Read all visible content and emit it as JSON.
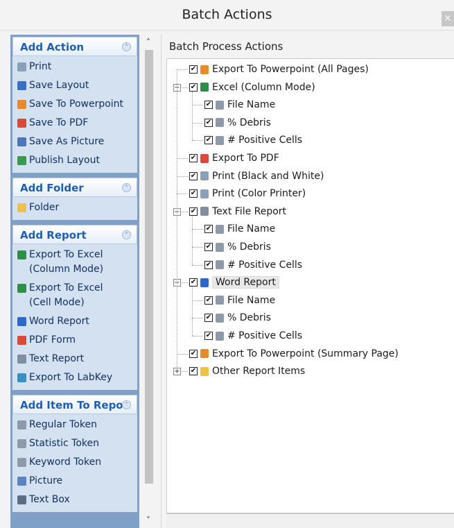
{
  "window": {
    "title": "Batch Actions",
    "close_glyph": "×"
  },
  "sidebar": {
    "sections": [
      {
        "title": "Add Action",
        "items": [
          {
            "label": "Print",
            "icon": "printer-icon",
            "color": "#8aa0b8"
          },
          {
            "label": "Save Layout",
            "icon": "floppy-icon",
            "color": "#3a6fc2"
          },
          {
            "label": "Save To Powerpoint",
            "icon": "powerpoint-icon",
            "color": "#e58b2f"
          },
          {
            "label": "Save To PDF",
            "icon": "pdf-icon",
            "color": "#d94a3a"
          },
          {
            "label": "Save As Picture",
            "icon": "picture-icon",
            "color": "#4b77b8"
          },
          {
            "label": "Publish Layout",
            "icon": "globe-icon",
            "color": "#3a9a4e"
          }
        ]
      },
      {
        "title": "Add Folder",
        "items": [
          {
            "label": "Folder",
            "icon": "folder-icon",
            "color": "#e9c34a"
          }
        ]
      },
      {
        "title": "Add Report",
        "items": [
          {
            "label": "Export To Excel\n(Column Mode)",
            "icon": "excel-icon",
            "color": "#2f8f4a"
          },
          {
            "label": "Export To Excel\n(Cell Mode)",
            "icon": "excel-icon",
            "color": "#2f8f4a"
          },
          {
            "label": "Word Report",
            "icon": "word-icon",
            "color": "#2f67c7"
          },
          {
            "label": "PDF Form",
            "icon": "pdf-icon",
            "color": "#d94a3a"
          },
          {
            "label": "Text Report",
            "icon": "text-file-icon",
            "color": "#7f8ea0"
          },
          {
            "label": "Export To LabKey",
            "icon": "labkey-icon",
            "color": "#3a8fc2"
          }
        ]
      },
      {
        "title": "Add Item To Repo",
        "items": [
          {
            "label": "Regular Token",
            "icon": "token-icon",
            "color": "#8e9aaa"
          },
          {
            "label": "Statistic Token",
            "icon": "token-icon",
            "color": "#8e9aaa"
          },
          {
            "label": "Keyword Token",
            "icon": "token-icon",
            "color": "#8e9aaa"
          },
          {
            "label": "Picture",
            "icon": "picture-icon",
            "color": "#5a84bd"
          },
          {
            "label": "Text Box",
            "icon": "textbox-icon",
            "color": "#5b6e86"
          }
        ]
      }
    ],
    "collapse_glyph": "˄"
  },
  "panel": {
    "title": "Batch Process Actions"
  },
  "tree": [
    {
      "label": "Export To Powerpoint (All Pages)",
      "icon": "powerpoint-icon",
      "color": "#e58b2f",
      "level": 1,
      "checked": true
    },
    {
      "label": "Excel (Column Mode)",
      "icon": "excel-icon",
      "color": "#2f8f4a",
      "level": 0,
      "checked": true,
      "expander": "−"
    },
    {
      "label": "File Name",
      "icon": "token-icon",
      "color": "#8e9aaa",
      "level": 2,
      "checked": true
    },
    {
      "label": "% Debris",
      "icon": "token-icon",
      "color": "#8e9aaa",
      "level": 2,
      "checked": true
    },
    {
      "label": "# Positive Cells",
      "icon": "token-icon",
      "color": "#8e9aaa",
      "level": 2,
      "checked": true
    },
    {
      "label": "Export To PDF",
      "icon": "pdf-icon",
      "color": "#d94a3a",
      "level": 1,
      "checked": true
    },
    {
      "label": "Print (Black and White)",
      "icon": "printer-icon",
      "color": "#8aa0b8",
      "level": 1,
      "checked": true
    },
    {
      "label": "Print (Color Printer)",
      "icon": "printer-icon",
      "color": "#8aa0b8",
      "level": 1,
      "checked": true
    },
    {
      "label": "Text File Report",
      "icon": "text-file-icon",
      "color": "#7f8ea0",
      "level": 0,
      "checked": true,
      "expander": "−"
    },
    {
      "label": "File Name",
      "icon": "token-icon",
      "color": "#8e9aaa",
      "level": 2,
      "checked": true
    },
    {
      "label": "% Debris",
      "icon": "token-icon",
      "color": "#8e9aaa",
      "level": 2,
      "checked": true
    },
    {
      "label": "# Positive Cells",
      "icon": "token-icon",
      "color": "#8e9aaa",
      "level": 2,
      "checked": true
    },
    {
      "label": "Word Report",
      "icon": "word-icon",
      "color": "#2f67c7",
      "level": 0,
      "checked": true,
      "expander": "−",
      "selected": true
    },
    {
      "label": "File Name",
      "icon": "token-icon",
      "color": "#8e9aaa",
      "level": 2,
      "checked": true
    },
    {
      "label": "% Debris",
      "icon": "token-icon",
      "color": "#8e9aaa",
      "level": 2,
      "checked": true
    },
    {
      "label": "# Positive Cells",
      "icon": "token-icon",
      "color": "#8e9aaa",
      "level": 2,
      "checked": true
    },
    {
      "label": "Export To Powerpoint (Summary Page)",
      "icon": "powerpoint-icon",
      "color": "#e58b2f",
      "level": 1,
      "checked": true
    },
    {
      "label": "Other Report Items",
      "icon": "folder-icon",
      "color": "#e9c34a",
      "level": 0,
      "checked": true,
      "expander": "+"
    }
  ],
  "scroll": {
    "up_glyph": "˄",
    "down_glyph": "˅"
  },
  "checkbox_glyph": "✔"
}
